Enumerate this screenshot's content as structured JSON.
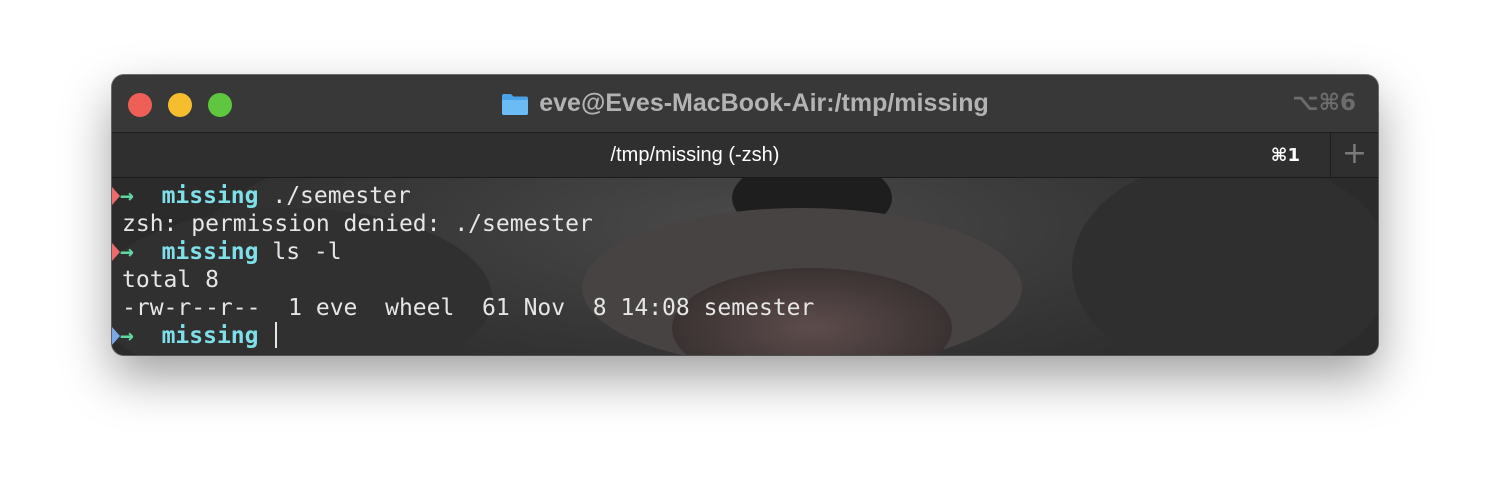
{
  "window": {
    "title": "eve@Eves-MacBook-Air:/tmp/missing",
    "shortcut": "⌥⌘6"
  },
  "tab": {
    "title": "/tmp/missing (-zsh)",
    "shortcut": "⌘1",
    "new_tab_symbol": "+"
  },
  "colors": {
    "prompt_arrow": "#5fd7a0",
    "directory": "#7fe0ea",
    "error_marker": "#ee6b6b",
    "ok_marker": "#7aa7e8"
  },
  "terminal": {
    "lines": [
      {
        "type": "prompt",
        "status": "error",
        "arrow": "→",
        "dir": "missing",
        "cmd": " ./semester"
      },
      {
        "type": "output",
        "text": "zsh: permission denied: ./semester"
      },
      {
        "type": "prompt",
        "status": "error",
        "arrow": "→",
        "dir": "missing",
        "cmd": " ls -l"
      },
      {
        "type": "output",
        "text": "total 8"
      },
      {
        "type": "output",
        "text": "-rw-r--r--  1 eve  wheel  61 Nov  8 14:08 semester"
      },
      {
        "type": "prompt",
        "status": "ok",
        "arrow": "→",
        "dir": "missing",
        "cmd": " "
      }
    ]
  }
}
